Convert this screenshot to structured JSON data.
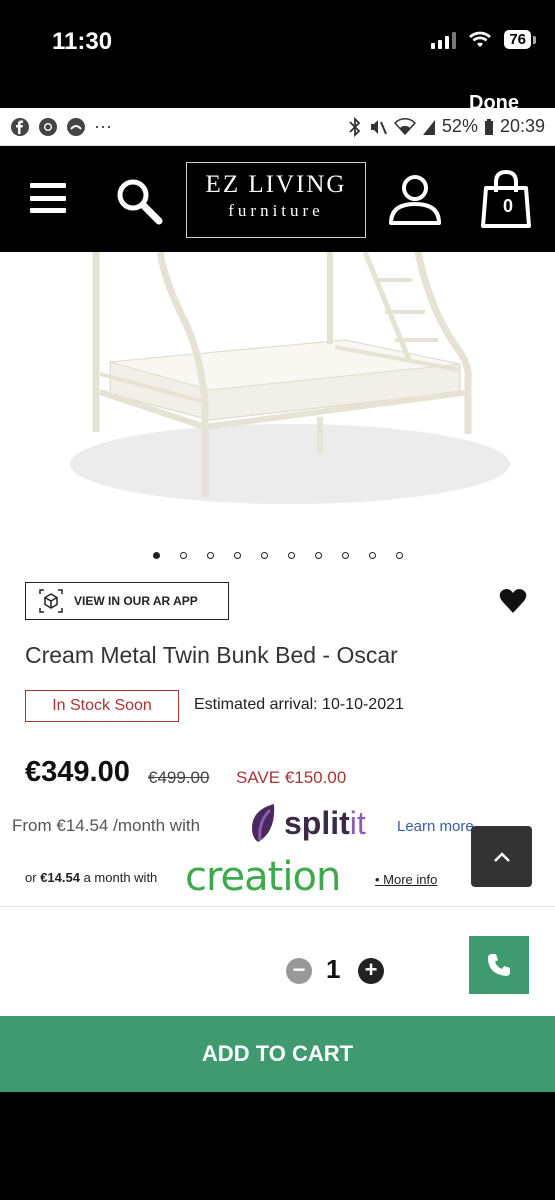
{
  "ios_status": {
    "time": "11:30",
    "battery": "76",
    "done_label": "Done"
  },
  "android_status": {
    "dots": "···",
    "battery": "52%",
    "time": "20:39"
  },
  "header": {
    "logo_line1": "EZ LIVING",
    "logo_line2": "furniture",
    "cart_count": "0"
  },
  "product": {
    "image_alt": "cream metal twin bunk bed",
    "carousel_count": 10,
    "carousel_active": 0,
    "ar_label": "VIEW IN OUR AR APP",
    "title": "Cream Metal Twin Bunk Bed - Oscar",
    "stock": "In Stock Soon",
    "estimated_arrival": "Estimated arrival: 10-10-2021",
    "price": "€349.00",
    "was_price": "€499.00",
    "save": "SAVE €150.00"
  },
  "finance": {
    "splitit_text": "From €14.54 /month with",
    "splitit_brand": "split",
    "splitit_suffix": "it",
    "learn_more": "Learn more",
    "creation_prefix": "or",
    "creation_amount": "€14.54",
    "creation_suffix": "a month with",
    "creation_brand": "creation",
    "more_info": "More info"
  },
  "purchase": {
    "qty_minus": "−",
    "qty": "1",
    "qty_plus": "+",
    "add_to_cart": "ADD TO CART"
  },
  "colors": {
    "accent_green": "#3f9b6f",
    "stock_red": "#aa3333",
    "header_bg": "#000000"
  }
}
